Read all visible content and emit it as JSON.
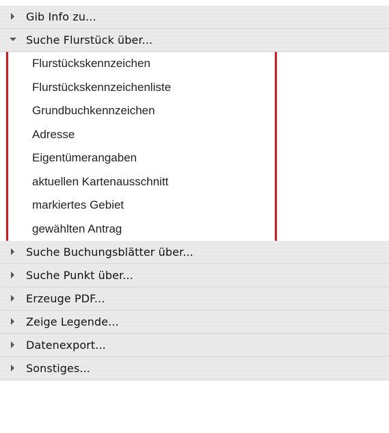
{
  "sections": [
    {
      "label": "Gib Info zu...",
      "expanded": false
    },
    {
      "label": "Suche Flurstück über...",
      "expanded": true
    },
    {
      "label": "Suche Buchungsblätter über...",
      "expanded": false
    },
    {
      "label": "Suche Punkt über...",
      "expanded": false
    },
    {
      "label": "Erzeuge PDF...",
      "expanded": false
    },
    {
      "label": "Zeige Legende...",
      "expanded": false
    },
    {
      "label": "Datenexport...",
      "expanded": false
    },
    {
      "label": "Sonstiges...",
      "expanded": false
    }
  ],
  "flurstueck_items": [
    "Flurstückskennzeichen",
    "Flurstückskennzeichenliste",
    "Grundbuchkennzeichen",
    "Adresse",
    "Eigentümerangaben",
    "aktuellen Kartenausschnitt",
    "markiertes Gebiet",
    "gewählten Antrag"
  ],
  "colors": {
    "highlight": "#e0121a",
    "header_light": "#f0f0f0",
    "header_dark": "#e2e2e2",
    "arrow": "#555555"
  }
}
